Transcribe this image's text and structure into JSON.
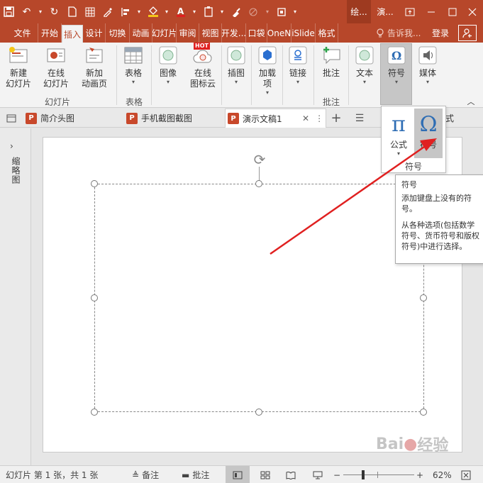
{
  "titlebar": {
    "context_tab_1": "绘...",
    "context_tab_2": "演...",
    "accent_color": "#b7472a"
  },
  "tabs": [
    "文件",
    "开始",
    "插入",
    "设计",
    "切换",
    "动画",
    "幻灯片",
    "审阅",
    "视图",
    "开发...",
    "口袋",
    "OneN",
    "iSlide",
    "格式"
  ],
  "active_tab": "插入",
  "tellme": "告诉我...",
  "login": "登录",
  "ribbon": {
    "new_slide": "新建\n幻灯片",
    "online_slide": "在线\n幻灯片",
    "new_anim_page": "新加\n动画页",
    "table": "表格",
    "image": "图像",
    "online_icon_cloud": "在线\n图标云",
    "hot_badge": "HOT",
    "illustration": "插图",
    "addin": "加载\n项",
    "link": "链接",
    "comment": "批注",
    "text": "文本",
    "symbol": "符号",
    "media": "媒体",
    "groups": {
      "slides": "幻灯片",
      "tables": "表格",
      "comments": "批注"
    }
  },
  "doctabs": [
    {
      "label": "简介头图",
      "active": false
    },
    {
      "label": "手机截图截图",
      "active": false
    },
    {
      "label": "演示文稿1",
      "active": true
    }
  ],
  "view_mode": "窗口模式",
  "left_panel": {
    "label": "缩略图"
  },
  "dropdown": {
    "formula_glyph": "π",
    "formula_label": "公式",
    "symbol_glyph": "Ω",
    "symbol_label": "符号",
    "group_label": "符号"
  },
  "tooltip": {
    "title": "符号",
    "line1": "添加键盘上没有的符号。",
    "line2": "从各种选项(包括数学符号、货币符号和版权符号)中进行选择。"
  },
  "statusbar": {
    "slide_info": "幻灯片 第 1 张，共 1 张",
    "notes": "备注",
    "comments": "批注",
    "zoom": "62%"
  }
}
